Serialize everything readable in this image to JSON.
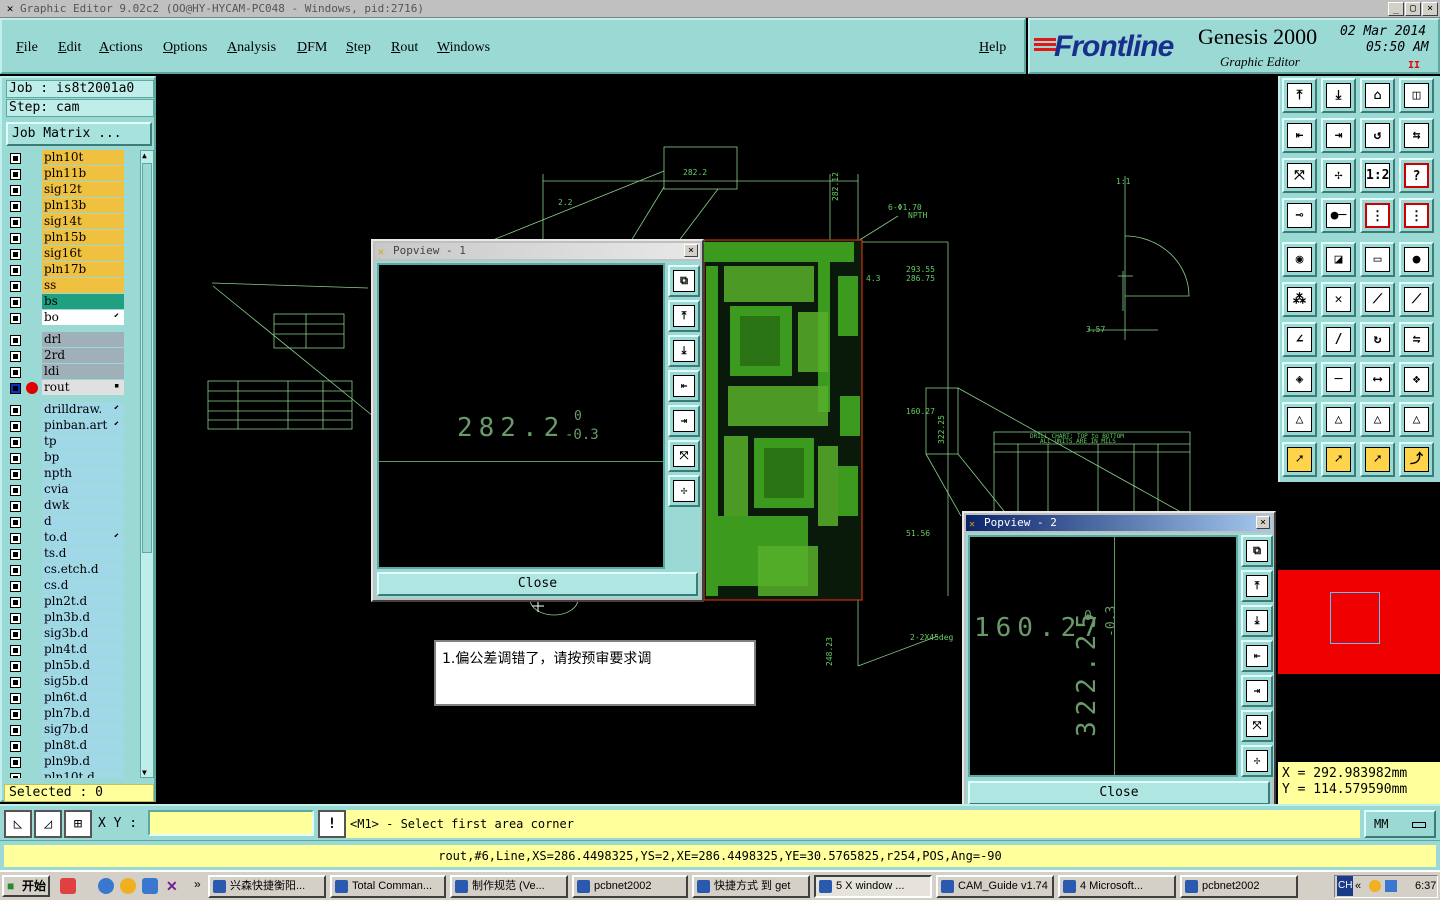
{
  "window": {
    "title": "Graphic Editor 9.02c2 (OO@HY-HYCAM-PC048 - Windows, pid:2716)",
    "min": "_",
    "max": "▢",
    "close": "×"
  },
  "menu": {
    "file": "File",
    "edit": "Edit",
    "actions": "Actions",
    "options": "Options",
    "analysis": "Analysis",
    "dfm": "DFM",
    "step": "Step",
    "rout": "Rout",
    "windows": "Windows",
    "help": "Help"
  },
  "brand": {
    "logo": "Frontline",
    "product": "Genesis 2000",
    "subtitle": "Graphic Editor",
    "date": "02 Mar 2014",
    "time": "05:50 AM",
    "pause": "II"
  },
  "job": {
    "job_line": "Job : is8t2001a0",
    "step_line": "Step: cam",
    "matrix_button": "Job Matrix ..."
  },
  "layers": [
    {
      "name": "pln10t",
      "color": "#f0c040",
      "mark": ""
    },
    {
      "name": "pln11b",
      "color": "#f0c040",
      "mark": ""
    },
    {
      "name": "sig12t",
      "color": "#f0c040",
      "mark": ""
    },
    {
      "name": "pln13b",
      "color": "#f0c040",
      "mark": ""
    },
    {
      "name": "sig14t",
      "color": "#f0c040",
      "mark": ""
    },
    {
      "name": "pln15b",
      "color": "#f0c040",
      "mark": ""
    },
    {
      "name": "sig16t",
      "color": "#f0c040",
      "mark": ""
    },
    {
      "name": "pln17b",
      "color": "#f0c040",
      "mark": ""
    },
    {
      "name": "ss",
      "color": "#f0c040",
      "mark": ""
    },
    {
      "name": "bs",
      "color": "#20a080",
      "mark": ""
    },
    {
      "name": "bo",
      "color": "#ffffff",
      "mark": "⬋"
    },
    {
      "gap": true
    },
    {
      "name": "drl",
      "color": "#a0b0b8",
      "mark": ""
    },
    {
      "name": "2rd",
      "color": "#a0b0b8",
      "mark": ""
    },
    {
      "name": "ldi",
      "color": "#a0b0b8",
      "mark": ""
    },
    {
      "name": "rout",
      "color": "#e0e0e0",
      "mark": "▪",
      "active": true
    },
    {
      "gap": true
    },
    {
      "name": "drilldraw.",
      "color": "#a0d8e8",
      "mark": "⬋"
    },
    {
      "name": "pinban.art",
      "color": "#a0d8e8",
      "mark": "⬋"
    },
    {
      "name": "tp",
      "color": "#a0d8e8",
      "mark": ""
    },
    {
      "name": "bp",
      "color": "#a0d8e8",
      "mark": ""
    },
    {
      "name": "npth",
      "color": "#a0d8e8",
      "mark": ""
    },
    {
      "name": "cvia",
      "color": "#a0d8e8",
      "mark": ""
    },
    {
      "name": "dwk",
      "color": "#a0d8e8",
      "mark": ""
    },
    {
      "name": "d",
      "color": "#a0d8e8",
      "mark": ""
    },
    {
      "name": "to.d",
      "color": "#a0d8e8",
      "mark": "⬋"
    },
    {
      "name": "ts.d",
      "color": "#a0d8e8",
      "mark": ""
    },
    {
      "name": "cs.etch.d",
      "color": "#a0d8e8",
      "mark": ""
    },
    {
      "name": "cs.d",
      "color": "#a0d8e8",
      "mark": ""
    },
    {
      "name": "pln2t.d",
      "color": "#a0d8e8",
      "mark": ""
    },
    {
      "name": "pln3b.d",
      "color": "#a0d8e8",
      "mark": ""
    },
    {
      "name": "sig3b.d",
      "color": "#a0d8e8",
      "mark": ""
    },
    {
      "name": "pln4t.d",
      "color": "#a0d8e8",
      "mark": ""
    },
    {
      "name": "pln5b.d",
      "color": "#a0d8e8",
      "mark": ""
    },
    {
      "name": "sig5b.d",
      "color": "#a0d8e8",
      "mark": ""
    },
    {
      "name": "pln6t.d",
      "color": "#a0d8e8",
      "mark": ""
    },
    {
      "name": "pln7b.d",
      "color": "#a0d8e8",
      "mark": ""
    },
    {
      "name": "sig7b.d",
      "color": "#a0d8e8",
      "mark": ""
    },
    {
      "name": "pln8t.d",
      "color": "#a0d8e8",
      "mark": ""
    },
    {
      "name": "pln9b.d",
      "color": "#a0d8e8",
      "mark": ""
    },
    {
      "name": "pln10t.d",
      "color": "#a0d8e8",
      "mark": ""
    }
  ],
  "selected": "Selected : 0",
  "canvas_labels": {
    "top_dim": "282.2",
    "right_dim_1": "282.12",
    "right_dim_2": "293.55",
    "right_dim_3": "286.75",
    "right_dim_4": "160.27",
    "right_dim_5": "322.25",
    "right_dim_6": "51.56",
    "bottom_dim": "248.23",
    "npth_note": "6-Φ1.70",
    "npth_label": "NPTH",
    "chamfer": "2-2X45deg",
    "left_dim": "2.2",
    "offset": "4.3",
    "small_dim": "3.57",
    "scale_label": "1:1",
    "drill_chart_title": "DRILL CHART: TOP to BOTTOM",
    "drill_chart_sub": "ALL UNITS ARE IN MILS"
  },
  "popview1": {
    "title": "Popview - 1",
    "value": "282.2",
    "tol_plus": "0",
    "tol_minus": "-0.3",
    "close": "Close"
  },
  "popview2": {
    "title": "Popview - 2",
    "value_h": "160.27",
    "value_v": "322.25",
    "tol_plus": "0",
    "tol_minus": "-0.3",
    "close": "Close"
  },
  "note": "1.偏公差调错了，请按预审要求调",
  "coords": {
    "x": "X = 292.983982mm",
    "y": "Y = 114.579590mm"
  },
  "command": {
    "xy_label": "X Y :",
    "xy_value": "",
    "warn": "!",
    "prompt": "<M1> - Select first area corner",
    "units": "MM"
  },
  "status": "rout,#6,Line,XS=286.4498325,YS=2,XE=286.4498325,YE=30.5765825,r254,POS,Ang=-90",
  "taskbar": {
    "start": "开始",
    "quick_more": "»",
    "tasks": [
      "兴森快捷衡阳...",
      "Total Comman...",
      "制作规范 (Ve...",
      "pcbnet2002",
      "快捷方式 到 get",
      "5 X window ...",
      "CAM_Guide v1.74",
      "4 Microsoft...",
      "pcbnet2002"
    ],
    "tray_lang": "CH",
    "tray_arrow": "«",
    "clock": "6:37"
  }
}
